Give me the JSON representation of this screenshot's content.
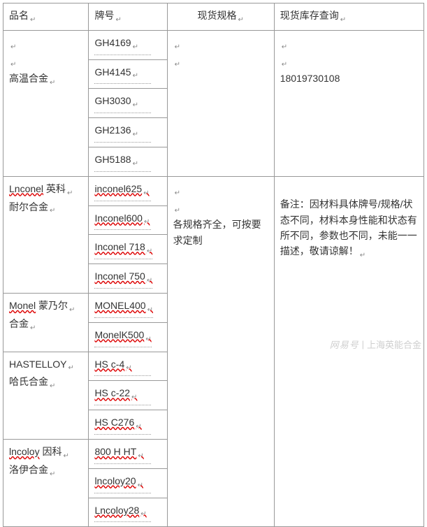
{
  "headers": {
    "name": "品名",
    "grade": "牌号",
    "spec": "现货规格",
    "stock": "现货库存查询"
  },
  "groups": [
    {
      "name_lines": [
        "",
        "",
        "高温合金"
      ],
      "grades": [
        "GH4169",
        "GH4145",
        "GH3030",
        "GH2136",
        "GH5188"
      ],
      "name_plain": true
    },
    {
      "name_lines": [
        "Lnconel 英科",
        "耐尔合金"
      ],
      "grades": [
        "inconel625",
        "Inconel600",
        "Inconel 718",
        "Inconel 750"
      ],
      "name_wavy": [
        true,
        false
      ]
    },
    {
      "name_lines": [
        "Monel 蒙乃尔",
        "合金"
      ],
      "grades": [
        "MONEL400",
        "MonelK500"
      ],
      "name_wavy": [
        true,
        false
      ]
    },
    {
      "name_lines": [
        "HASTELLOY",
        "哈氏合金"
      ],
      "grades": [
        "HS c-4",
        "HS c-22",
        "HS C276"
      ]
    },
    {
      "name_lines": [
        "lncoloy 因科",
        "洛伊合金"
      ],
      "grades": [
        "800 H HT",
        "lncoloy20",
        "Lncoloy28"
      ],
      "name_wavy": [
        true,
        false
      ]
    }
  ],
  "spec_text": "各规格齐全，可按要求定制",
  "stock_phone": "18019730108",
  "stock_note": "备注：因材料具体牌号/规格/状态不同，材料本身性能和状态有所不同，参数也不同，未能一一描述，敬请谅解！",
  "watermark": {
    "site": "网易号",
    "author": "上海英能合金"
  }
}
